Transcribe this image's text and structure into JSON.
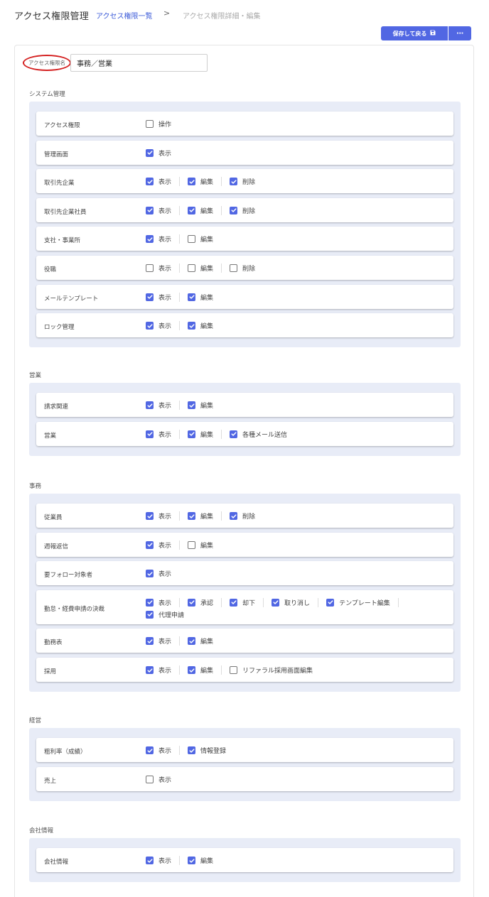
{
  "header": {
    "title": "アクセス権限管理",
    "breadcrumb_link": "アクセス権限一覧",
    "breadcrumb_sep": ">",
    "breadcrumb_current": "アクセス権限詳細・編集"
  },
  "toolbar": {
    "save_label": "保存して戻る",
    "save_icon": "floppy-disk-icon",
    "more_label": "···"
  },
  "form": {
    "name_label": "アクセス権限名",
    "name_value": "事務／営業"
  },
  "colors": {
    "accent": "#5167e3",
    "panel": "#e8ecf7",
    "highlight": "#d42020"
  },
  "sections": [
    {
      "title": "システム管理",
      "rows": [
        {
          "label": "アクセス権限",
          "perms": [
            {
              "label": "操作",
              "checked": false
            }
          ]
        },
        {
          "label": "管理画面",
          "perms": [
            {
              "label": "表示",
              "checked": true
            }
          ]
        },
        {
          "label": "取引先企業",
          "perms": [
            {
              "label": "表示",
              "checked": true
            },
            {
              "label": "編集",
              "checked": true
            },
            {
              "label": "削除",
              "checked": true
            }
          ]
        },
        {
          "label": "取引先企業社員",
          "perms": [
            {
              "label": "表示",
              "checked": true
            },
            {
              "label": "編集",
              "checked": true
            },
            {
              "label": "削除",
              "checked": true
            }
          ]
        },
        {
          "label": "支社・事業所",
          "perms": [
            {
              "label": "表示",
              "checked": true
            },
            {
              "label": "編集",
              "checked": false
            }
          ]
        },
        {
          "label": "役職",
          "perms": [
            {
              "label": "表示",
              "checked": false
            },
            {
              "label": "編集",
              "checked": false
            },
            {
              "label": "削除",
              "checked": false
            }
          ]
        },
        {
          "label": "メールテンプレート",
          "perms": [
            {
              "label": "表示",
              "checked": true
            },
            {
              "label": "編集",
              "checked": true
            }
          ]
        },
        {
          "label": "ロック管理",
          "perms": [
            {
              "label": "表示",
              "checked": true
            },
            {
              "label": "編集",
              "checked": true
            }
          ]
        }
      ]
    },
    {
      "title": "営業",
      "rows": [
        {
          "label": "請求関連",
          "perms": [
            {
              "label": "表示",
              "checked": true
            },
            {
              "label": "編集",
              "checked": true
            }
          ]
        },
        {
          "label": "営業",
          "perms": [
            {
              "label": "表示",
              "checked": true
            },
            {
              "label": "編集",
              "checked": true
            },
            {
              "label": "各種メール送信",
              "checked": true
            }
          ]
        }
      ]
    },
    {
      "title": "事務",
      "rows": [
        {
          "label": "従業員",
          "perms": [
            {
              "label": "表示",
              "checked": true
            },
            {
              "label": "編集",
              "checked": true
            },
            {
              "label": "削除",
              "checked": true
            }
          ]
        },
        {
          "label": "週報返信",
          "perms": [
            {
              "label": "表示",
              "checked": true
            },
            {
              "label": "編集",
              "checked": false
            }
          ]
        },
        {
          "label": "要フォロー対象者",
          "perms": [
            {
              "label": "表示",
              "checked": true
            }
          ]
        },
        {
          "label": "勤怠・経費申請の決裁",
          "tall": true,
          "perms": [
            {
              "label": "表示",
              "checked": true
            },
            {
              "label": "承認",
              "checked": true
            },
            {
              "label": "却下",
              "checked": true
            },
            {
              "label": "取り消し",
              "checked": true
            },
            {
              "label": "テンプレート編集",
              "checked": true
            },
            {
              "label": "代理申請",
              "checked": true
            }
          ]
        },
        {
          "label": "勤務表",
          "perms": [
            {
              "label": "表示",
              "checked": true
            },
            {
              "label": "編集",
              "checked": true
            }
          ]
        },
        {
          "label": "採用",
          "perms": [
            {
              "label": "表示",
              "checked": true
            },
            {
              "label": "編集",
              "checked": true
            },
            {
              "label": "リファラル採用画面編集",
              "checked": false
            }
          ]
        }
      ]
    },
    {
      "title": "経営",
      "rows": [
        {
          "label": "粗利率（成績）",
          "perms": [
            {
              "label": "表示",
              "checked": true
            },
            {
              "label": "情報登録",
              "checked": true
            }
          ]
        },
        {
          "label": "売上",
          "perms": [
            {
              "label": "表示",
              "checked": false
            }
          ]
        }
      ]
    },
    {
      "title": "会社情報",
      "rows": [
        {
          "label": "会社情報",
          "perms": [
            {
              "label": "表示",
              "checked": true
            },
            {
              "label": "編集",
              "checked": true
            }
          ]
        }
      ]
    }
  ]
}
